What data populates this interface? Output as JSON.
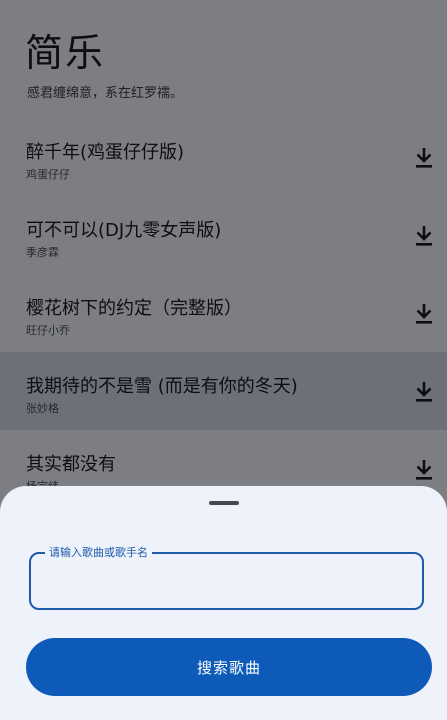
{
  "app": {
    "title": "简乐",
    "subtitle": "感君缠绵意，系在红罗襦。"
  },
  "songs": [
    {
      "title": "醉千年(鸡蛋仔仔版)",
      "artist": "鸡蛋仔仔"
    },
    {
      "title": "可不可以(DJ九零女声版)",
      "artist": "季彦霖"
    },
    {
      "title": "樱花树下的约定（完整版）",
      "artist": "旺仔小乔"
    },
    {
      "title": "我期待的不是雪 (而是有你的冬天)",
      "artist": "张妙格"
    },
    {
      "title": "其实都没有",
      "artist": "杨宗纬"
    }
  ],
  "icons": {
    "download": "download-icon"
  },
  "search_sheet": {
    "input_label": "请输入歌曲或歌手名",
    "input_value": "",
    "button_label": "搜索歌曲"
  },
  "colors": {
    "accent": "#0d5ab8",
    "field_border": "#1f5aa8",
    "highlight_row": "#d2d7e6",
    "background": "#eef2fb"
  }
}
